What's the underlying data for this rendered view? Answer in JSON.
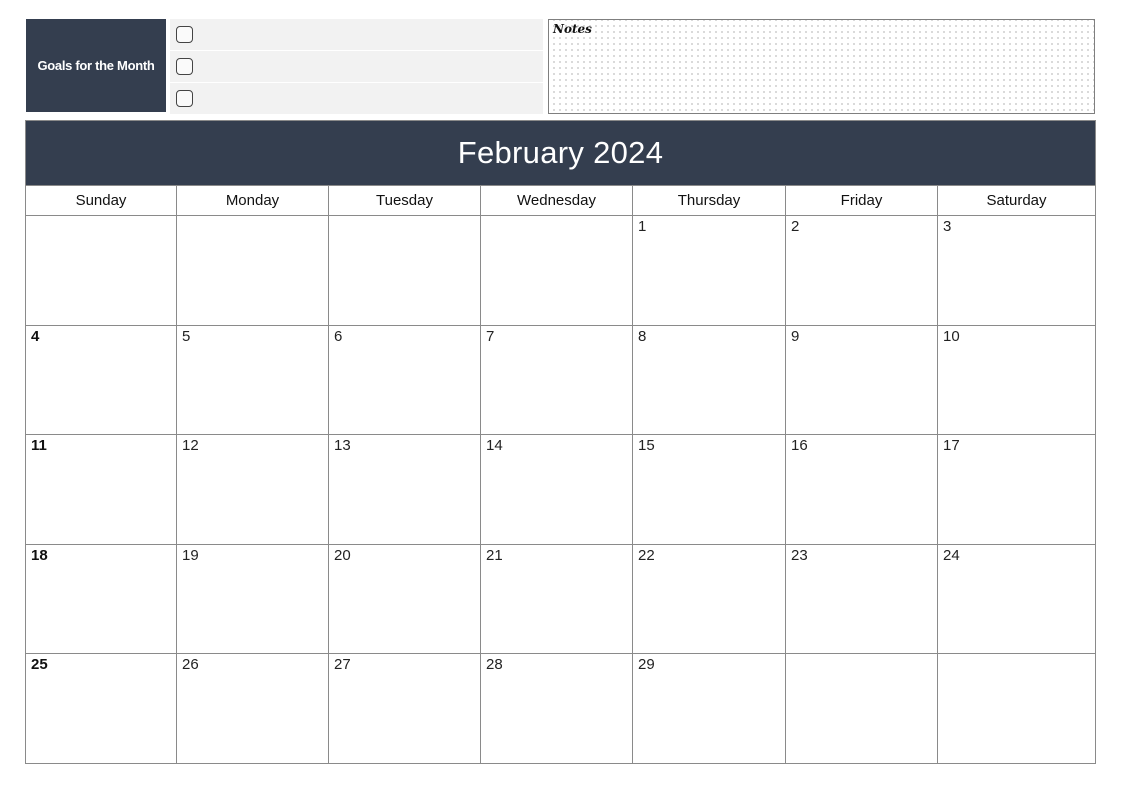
{
  "goals": {
    "label": "Goals for the Month",
    "items": [
      {
        "checked": false,
        "text": ""
      },
      {
        "checked": false,
        "text": ""
      },
      {
        "checked": false,
        "text": ""
      }
    ]
  },
  "notes": {
    "label": "Notes",
    "content": ""
  },
  "calendar": {
    "title": "February 2024",
    "weekdays": [
      "Sunday",
      "Monday",
      "Tuesday",
      "Wednesday",
      "Thursday",
      "Friday",
      "Saturday"
    ],
    "weeks": [
      [
        "",
        "",
        "",
        "",
        "1",
        "2",
        "3"
      ],
      [
        "4",
        "5",
        "6",
        "7",
        "8",
        "9",
        "10"
      ],
      [
        "11",
        "12",
        "13",
        "14",
        "15",
        "16",
        "17"
      ],
      [
        "18",
        "19",
        "20",
        "21",
        "22",
        "23",
        "24"
      ],
      [
        "25",
        "26",
        "27",
        "28",
        "29",
        "",
        ""
      ]
    ]
  },
  "colors": {
    "header_bg": "#343e4f",
    "goal_row_bg": "#f2f2f2",
    "grid_line": "#8a8a8a"
  }
}
